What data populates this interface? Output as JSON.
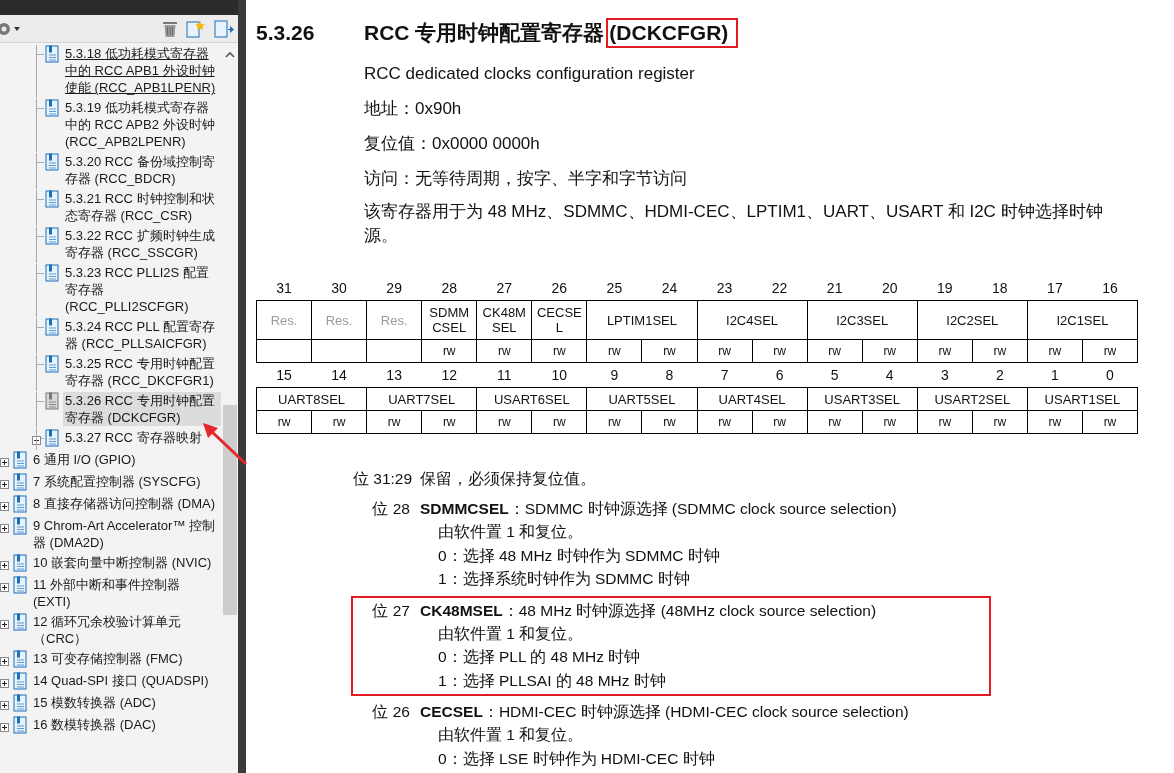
{
  "sidebar": {
    "sub_items": [
      {
        "label": "5.3.18 低功耗模式寄存器中的 RCC APB1 外设时钟使能 (RCC_APB1LPENR)",
        "expandable": false,
        "selected": false,
        "hovered": true
      },
      {
        "label": "5.3.19 低功耗模式寄存器中的 RCC APB2 外设时钟 (RCC_APB2LPENR)",
        "expandable": false,
        "selected": false,
        "hovered": false
      },
      {
        "label": "5.3.20 RCC 备份域控制寄存器 (RCC_BDCR)",
        "expandable": false,
        "selected": false,
        "hovered": false
      },
      {
        "label": "5.3.21 RCC 时钟控制和状态寄存器 (RCC_CSR)",
        "expandable": false,
        "selected": false,
        "hovered": false
      },
      {
        "label": "5.3.22 RCC 扩频时钟生成寄存器 (RCC_SSCGR)",
        "expandable": false,
        "selected": false,
        "hovered": false
      },
      {
        "label": "5.3.23 RCC PLLI2S 配置寄存器 (RCC_PLLI2SCFGR)",
        "expandable": false,
        "selected": false,
        "hovered": false
      },
      {
        "label": "5.3.24 RCC PLL 配置寄存器 (RCC_PLLSAICFGR)",
        "expandable": false,
        "selected": false,
        "hovered": false
      },
      {
        "label": "5.3.25 RCC 专用时钟配置寄存器 (RCC_DKCFGR1)",
        "expandable": false,
        "selected": false,
        "hovered": false
      },
      {
        "label": "5.3.26 RCC 专用时钟配置寄存器 (DCKCFGR)",
        "expandable": false,
        "selected": true,
        "hovered": false
      },
      {
        "label": "5.3.27 RCC 寄存器映射",
        "expandable": true,
        "selected": false,
        "hovered": false
      }
    ],
    "items": [
      {
        "label": "6 通用 I/O (GPIO)",
        "expandable": true,
        "selected": false
      },
      {
        "label": "7 系统配置控制器 (SYSCFG)",
        "expandable": true,
        "selected": false
      },
      {
        "label": "8 直接存储器访问控制器 (DMA)",
        "expandable": true,
        "selected": false
      },
      {
        "label": "9 Chrom-Art Accelerator™ 控制器 (DMA2D)",
        "expandable": true,
        "selected": false
      },
      {
        "label": "10 嵌套向量中断控制器 (NVIC)",
        "expandable": true,
        "selected": false
      },
      {
        "label": "11 外部中断和事件控制器 (EXTI)",
        "expandable": true,
        "selected": false
      },
      {
        "label": "12 循环冗余校验计算单元（CRC）",
        "expandable": true,
        "selected": false
      },
      {
        "label": "13 可变存储控制器 (FMC)",
        "expandable": true,
        "selected": false
      },
      {
        "label": "14 Quad-SPI 接口 (QUADSPI)",
        "expandable": true,
        "selected": false
      },
      {
        "label": "15 模数转换器 (ADC)",
        "expandable": true,
        "selected": false
      },
      {
        "label": "16 数模转换器 (DAC)",
        "expandable": true,
        "selected": false
      }
    ]
  },
  "document": {
    "section_number": "5.3.26",
    "title": "RCC 专用时钟配置寄存器",
    "title_highlighted": "(DCKCFGR)",
    "subtitle": "RCC dedicated clocks configuration register",
    "properties": [
      "地址：0x90h",
      "复位值：0x0000 0000h",
      "访问：无等待周期，按字、半字和字节访问"
    ],
    "description": "该寄存器用于为 48 MHz、SDMMC、HDMI-CEC、LPTIM1、UART、USART 和 I2C 时钟选择时钟源。",
    "register_rows": [
      {
        "bits": [
          "31",
          "30",
          "29",
          "28",
          "27",
          "26",
          "25",
          "24",
          "23",
          "22",
          "21",
          "20",
          "19",
          "18",
          "17",
          "16"
        ],
        "fields": [
          {
            "name": "Res.",
            "reserved": true
          },
          {
            "name": "Res.",
            "reserved": true
          },
          {
            "name": "Res.",
            "reserved": true
          },
          {
            "name": "SDMMCSEL",
            "reserved": false,
            "access": [
              "rw"
            ]
          },
          {
            "name": "CK48MSEL",
            "reserved": false,
            "access": [
              "rw"
            ]
          },
          {
            "name": "CECSEL",
            "reserved": false,
            "access": [
              "rw"
            ]
          },
          {
            "name": "LPTIM1SEL",
            "reserved": false,
            "access": [
              "rw",
              "rw"
            ]
          },
          {
            "name": "I2C4SEL",
            "reserved": false,
            "access": [
              "rw",
              "rw"
            ]
          },
          {
            "name": "I2C3SEL",
            "reserved": false,
            "access": [
              "rw",
              "rw"
            ]
          },
          {
            "name": "I2C2SEL",
            "reserved": false,
            "access": [
              "rw",
              "rw"
            ]
          },
          {
            "name": "I2C1SEL",
            "reserved": false,
            "access": [
              "rw",
              "rw"
            ]
          }
        ]
      },
      {
        "bits": [
          "15",
          "14",
          "13",
          "12",
          "11",
          "10",
          "9",
          "8",
          "7",
          "6",
          "5",
          "4",
          "3",
          "2",
          "1",
          "0"
        ],
        "fields": [
          {
            "name": "UART8SEL",
            "reserved": false,
            "access": [
              "rw",
              "rw"
            ]
          },
          {
            "name": "UART7SEL",
            "reserved": false,
            "access": [
              "rw",
              "rw"
            ]
          },
          {
            "name": "USART6SEL",
            "reserved": false,
            "access": [
              "rw",
              "rw"
            ]
          },
          {
            "name": "UART5SEL",
            "reserved": false,
            "access": [
              "rw",
              "rw"
            ]
          },
          {
            "name": "UART4SEL",
            "reserved": false,
            "access": [
              "rw",
              "rw"
            ]
          },
          {
            "name": "USART3SEL",
            "reserved": false,
            "access": [
              "rw",
              "rw"
            ]
          },
          {
            "name": "USART2SEL",
            "reserved": false,
            "access": [
              "rw",
              "rw"
            ]
          },
          {
            "name": "USART1SEL",
            "reserved": false,
            "access": [
              "rw",
              "rw"
            ]
          }
        ]
      }
    ],
    "bit_descriptions": [
      {
        "bit": "位 31:29",
        "text": "保留，必须保持复位值。",
        "highlighted": false
      },
      {
        "bit": "位 28",
        "text": "**SDMMCSEL**：SDMMC 时钟源选择 (SDMMC clock source selection)",
        "lines": [
          "由软件置 1 和复位。",
          "0：选择 48 MHz 时钟作为 SDMMC 时钟",
          "1：选择系统时钟作为 SDMMC 时钟"
        ],
        "highlighted": false
      },
      {
        "bit": "位 27",
        "text": "**CK48MSEL**：48 MHz 时钟源选择 (48MHz clock source selection)",
        "lines": [
          "由软件置 1 和复位。",
          "0：选择 PLL 的 48 MHz 时钟",
          "1：选择 PLLSAI 的 48 MHz 时钟"
        ],
        "highlighted": true
      },
      {
        "bit": "位 26",
        "text": "**CECSEL**：HDMI-CEC 时钟源选择 (HDMI-CEC clock source selection)",
        "lines": [
          "由软件置 1 和复位。",
          "0：选择 LSE 时钟作为 HDMI-CEC 时钟"
        ],
        "highlighted": false
      }
    ]
  }
}
